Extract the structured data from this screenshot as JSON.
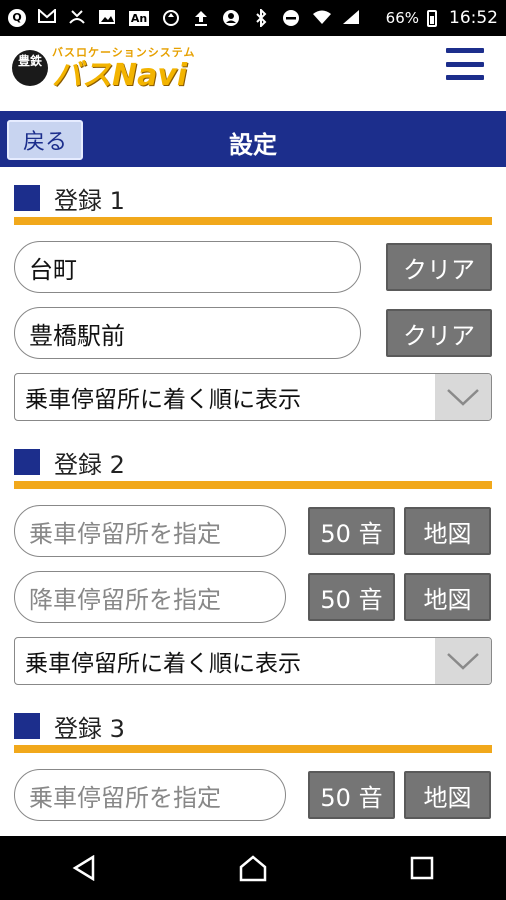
{
  "statusbar": {
    "battery_percent": "66%",
    "time": "16:52",
    "icons": [
      "q-circle-icon",
      "gmail-icon",
      "missed-call-icon",
      "image-icon",
      "an-icon",
      "recycle-icon",
      "upload-icon",
      "person-sync-icon",
      "bluetooth-icon",
      "dnd-icon",
      "wifi-icon",
      "signal-icon",
      "battery-icon"
    ],
    "an_label": "An",
    "q_label": "Q"
  },
  "app": {
    "logo_badge": "豊鉄",
    "logo_sub": "バスロケーションシステム",
    "logo_main": "バスNavi"
  },
  "titlebar": {
    "back_label": "戻る",
    "title": "設定"
  },
  "sections": [
    {
      "label": "登録 1",
      "field1": "台町",
      "field2": "豊橋駅前",
      "clear_label": "クリア",
      "select_value": "乗車停留所に着く順に表示"
    },
    {
      "label": "登録 2",
      "field1_placeholder": "乗車停留所を指定",
      "field2_placeholder": "降車停留所を指定",
      "fifty_label": "50 音",
      "map_label": "地図",
      "select_value": "乗車停留所に着く順に表示"
    },
    {
      "label": "登録 3",
      "field1_placeholder": "乗車停留所を指定",
      "fifty_label": "50 音",
      "map_label": "地図"
    }
  ],
  "colors": {
    "brand_navy": "#1c2e8c",
    "accent_orange": "#f1a81b",
    "button_gray": "#757575"
  }
}
